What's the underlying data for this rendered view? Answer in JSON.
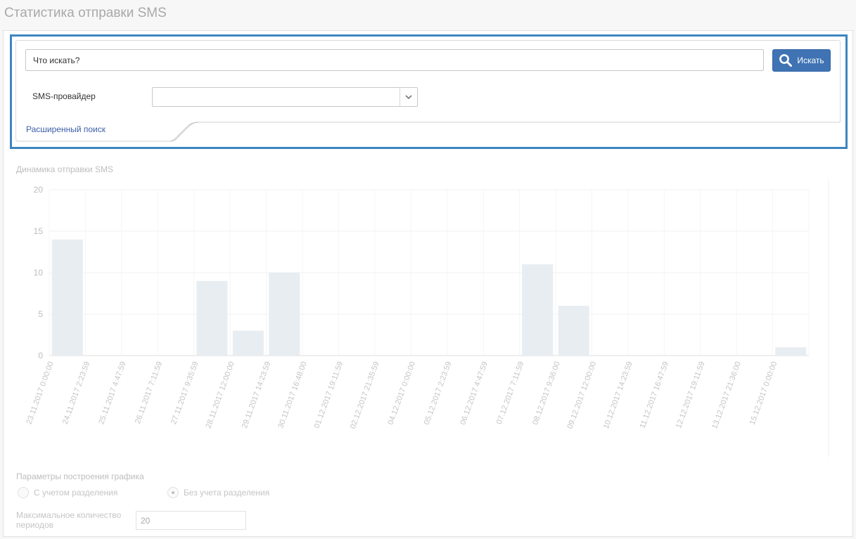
{
  "page": {
    "title": "Статистика отправки SMS"
  },
  "search": {
    "placeholder": "Что искать?",
    "button_label": "Искать",
    "provider_label": "SMS-провайдер",
    "provider_value": "",
    "advanced_link": "Расширенный поиск"
  },
  "colors": {
    "accent": "#3f73b4",
    "highlight_border": "#3d85c0",
    "bar": "#e8edf2",
    "link": "#3b5ea8"
  },
  "chart_data": {
    "type": "bar",
    "title": "Динамика отправки SMS",
    "xlabel": "",
    "ylabel": "",
    "ylim": [
      0,
      20
    ],
    "yticks": [
      0,
      5,
      10,
      15,
      20
    ],
    "grid": true,
    "legend": "none",
    "categories": [
      "23.11.2017 0:00:00",
      "24.11.2017 2:23:59",
      "25.11.2017 4:47:59",
      "26.11.2017 7:11:59",
      "27.11.2017 9:35:59",
      "28.11.2017 12:00:00",
      "29.11.2017 14:23:59",
      "30.11.2017 16:48:00",
      "01.12.2017 19:11:59",
      "02.12.2017 21:35:59",
      "04.12.2017 0:00:00",
      "05.12.2017 2:23:59",
      "06.12.2017 4:47:59",
      "07.12.2017 7:11:59",
      "08.12.2017 9:36:00",
      "09.12.2017 12:00:00",
      "10.12.2017 14:23:59",
      "11.12.2017 16:47:59",
      "12.12.2017 19:11:59",
      "13.12.2017 21:36:00",
      "15.12.2017 0:00:00"
    ],
    "values": [
      14,
      0,
      0,
      0,
      9,
      3,
      10,
      0,
      0,
      0,
      0,
      0,
      0,
      11,
      6,
      0,
      0,
      0,
      0,
      0,
      1
    ]
  },
  "chart_settings": {
    "title": "Параметры построения графика",
    "options": [
      {
        "label": "С учетом разделения",
        "checked": false
      },
      {
        "label": "Без учета разделения",
        "checked": true
      }
    ],
    "max_periods_label": "Максимальное количество периодов",
    "max_periods_value": "20"
  }
}
